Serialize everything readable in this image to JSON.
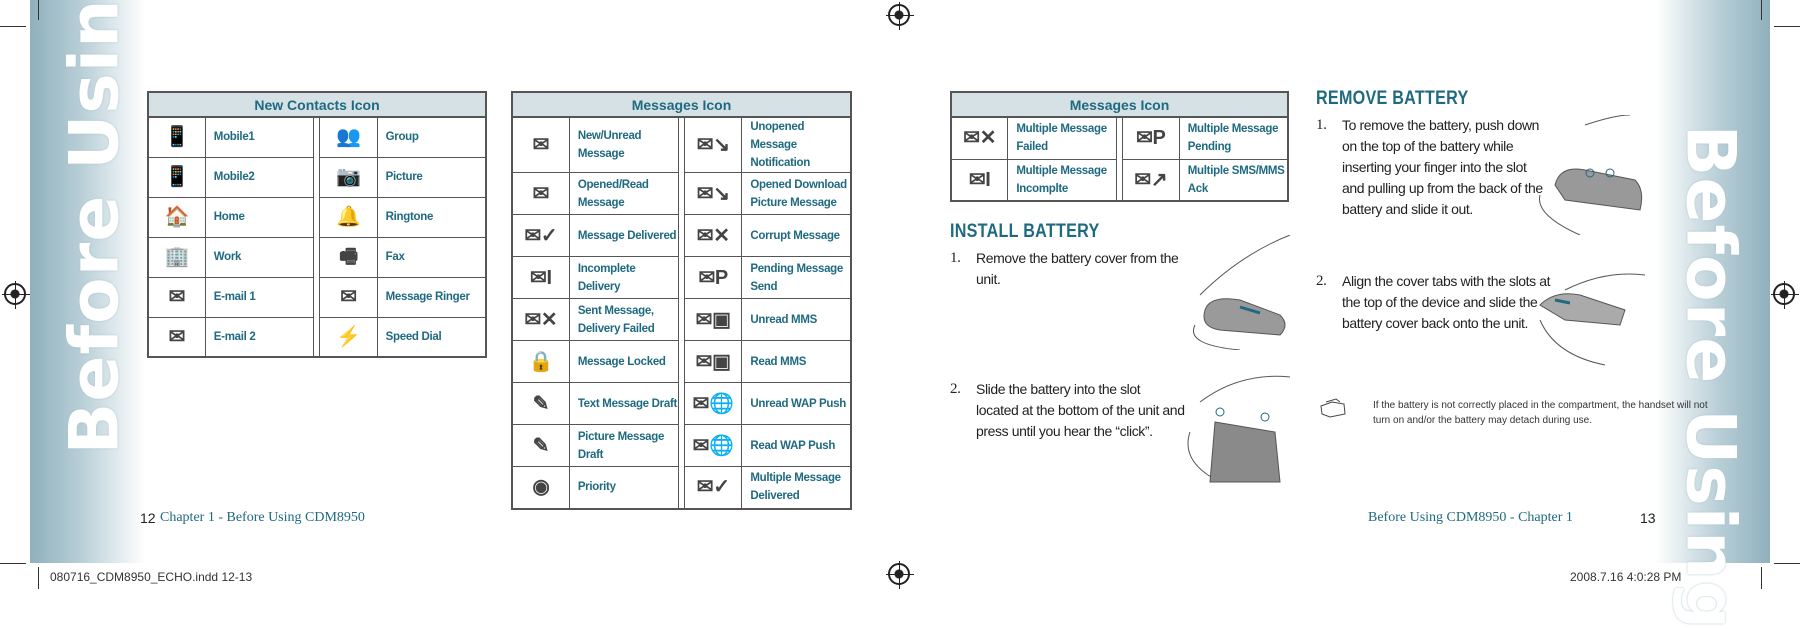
{
  "side_tab": "Before Using",
  "contacts_table": {
    "title": "New Contacts Icon",
    "rows": [
      [
        {
          "icon": "mobile1-icon",
          "glyph": "📱",
          "label": "Mobile1"
        },
        {
          "icon": "group-icon",
          "glyph": "👥",
          "label": "Group"
        }
      ],
      [
        {
          "icon": "mobile2-icon",
          "glyph": "📱",
          "label": "Mobile2"
        },
        {
          "icon": "picture-icon",
          "glyph": "📷",
          "label": "Picture"
        }
      ],
      [
        {
          "icon": "home-icon",
          "glyph": "🏠",
          "label": "Home"
        },
        {
          "icon": "ringtone-icon",
          "glyph": "🔔",
          "label": "Ringtone"
        }
      ],
      [
        {
          "icon": "work-icon",
          "glyph": "🏢",
          "label": "Work"
        },
        {
          "icon": "fax-icon",
          "glyph": "🖷",
          "label": "Fax"
        }
      ],
      [
        {
          "icon": "email-icon",
          "glyph": "✉",
          "label": "E-mail 1"
        },
        {
          "icon": "message-ringer-icon",
          "glyph": "✉",
          "label": "Message Ringer"
        }
      ],
      [
        {
          "icon": "email-icon",
          "glyph": "✉",
          "label": "E-mail 2"
        },
        {
          "icon": "speed-dial-icon",
          "glyph": "⚡",
          "label": "Speed Dial"
        }
      ]
    ]
  },
  "messages_table": {
    "title": "Messages Icon",
    "rows": [
      [
        {
          "icon": "envelope-icon",
          "glyph": "✉",
          "label": "New/Unread Message"
        },
        {
          "icon": "unopened-notification-icon",
          "glyph": "✉↘",
          "label": "Unopened Message Notification"
        }
      ],
      [
        {
          "icon": "open-envelope-icon",
          "glyph": "✉",
          "label": "Opened/Read Message"
        },
        {
          "icon": "opened-download-icon",
          "glyph": "✉↘",
          "label": "Opened Download Picture Message"
        }
      ],
      [
        {
          "icon": "message-delivered-icon",
          "glyph": "✉✓",
          "label": "Message Delivered"
        },
        {
          "icon": "corrupt-message-icon",
          "glyph": "✉✕",
          "label": "Corrupt Message"
        }
      ],
      [
        {
          "icon": "incomplete-delivery-icon",
          "glyph": "✉I",
          "label": "Incomplete Delivery"
        },
        {
          "icon": "pending-message-icon",
          "glyph": "✉P",
          "label": "Pending Message Send"
        }
      ],
      [
        {
          "icon": "delivery-failed-icon",
          "glyph": "✉✕",
          "label": "Sent Message, Delivery Failed"
        },
        {
          "icon": "unread-mms-icon",
          "glyph": "✉▣",
          "label": "Unread MMS"
        }
      ],
      [
        {
          "icon": "lock-icon",
          "glyph": "🔒",
          "label": "Message Locked"
        },
        {
          "icon": "read-mms-icon",
          "glyph": "✉▣",
          "label": "Read MMS"
        }
      ],
      [
        {
          "icon": "text-draft-icon",
          "glyph": "✎",
          "label": "Text Message Draft"
        },
        {
          "icon": "unread-wap-icon",
          "glyph": "✉🌐",
          "label": "Unread WAP Push"
        }
      ],
      [
        {
          "icon": "picture-draft-icon",
          "glyph": "✎",
          "label": "Picture Message Draft"
        },
        {
          "icon": "read-wap-icon",
          "glyph": "✉🌐",
          "label": "Read WAP Push"
        }
      ],
      [
        {
          "icon": "priority-icon",
          "glyph": "◉",
          "label": "Priority"
        },
        {
          "icon": "multiple-delivered-icon",
          "glyph": "✉✓",
          "label": "Multiple Message Delivered"
        }
      ]
    ]
  },
  "messages_table2": {
    "title": "Messages Icon",
    "rows": [
      [
        {
          "icon": "multiple-failed-icon",
          "glyph": "✉✕",
          "label": "Multiple Message Failed"
        },
        {
          "icon": "multiple-pending-icon",
          "glyph": "✉P",
          "label": "Multiple Message Pending"
        }
      ],
      [
        {
          "icon": "multiple-incomplete-icon",
          "glyph": "✉I",
          "label": "Multiple Message Incomplte"
        },
        {
          "icon": "multiple-ack-icon",
          "glyph": "✉↗",
          "label": "Multiple SMS/MMS Ack"
        }
      ]
    ]
  },
  "install": {
    "heading": "INSTALL BATTERY",
    "steps": [
      {
        "num": "1.",
        "text": "Remove the battery cover from the unit."
      },
      {
        "num": "2.",
        "text": "Slide the battery into the slot located at the bottom of the unit and press until you hear the “click”."
      }
    ]
  },
  "remove": {
    "heading": "REMOVE BATTERY",
    "steps": [
      {
        "num": "1.",
        "text": "To remove the battery, push down on the top of the battery while inserting your finger into the slot and pulling up from the back of the battery and slide it out."
      },
      {
        "num": "2.",
        "text": "Align the cover tabs with the slots at the top of the device and slide the battery cover back onto the unit."
      }
    ],
    "note": "If the battery is not correctly placed in the compartment, the handset will not turn on and/or the battery may detach during use."
  },
  "footer": {
    "left_page": "12",
    "left_title": "Chapter 1 - Before Using CDM8950",
    "right_title": "Before Using CDM8950 - Chapter 1",
    "right_page": "13",
    "slug_file": "080716_CDM8950_ECHO.indd   12-13",
    "slug_date": "2008.7.16   4:0:28 PM"
  },
  "colors": {
    "accent": "#1f6a80",
    "header_bg": "#d5e1e5",
    "band": "#8fb0bc"
  }
}
